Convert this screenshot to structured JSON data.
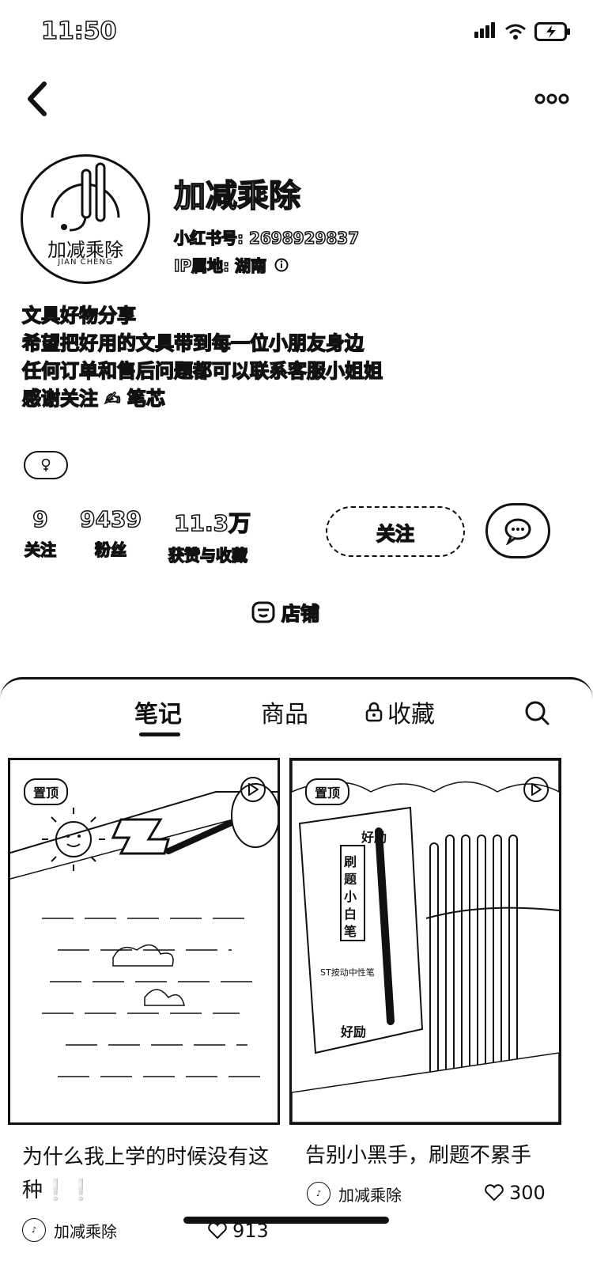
{
  "status": {
    "time": "11:50"
  },
  "profile": {
    "name": "加减乘除",
    "id_label": "小红书号: 2698929837",
    "ip_label": "IP属地: 湖南",
    "avatar_text": "加减乘除",
    "avatar_sub": "JIAN CHENG",
    "bio": [
      "文具好物分享",
      "希望把好用的文具带到每一位小朋友身边",
      "任何订单和售后问题都可以联系客服小姐姐",
      "感谢关注 ✍ 笔芯"
    ]
  },
  "stats": [
    {
      "value": "9",
      "label": "关注"
    },
    {
      "value": "9439",
      "label": "粉丝"
    },
    {
      "value": "11.3万",
      "label": "获赞与收藏"
    }
  ],
  "actions": {
    "follow": "关注",
    "shop": "店铺"
  },
  "tabs": [
    "笔记",
    "商品",
    "收藏"
  ],
  "cards": [
    {
      "pin": "置顶",
      "title": "为什么我上学的时候没有这种❕❕",
      "author": "加减乘除",
      "likes": "913"
    },
    {
      "pin": "置顶",
      "title": "告别小黑手，刷题不累手",
      "author": "加减乘除",
      "likes": "300",
      "img_brand": "好励",
      "img_words": "刷题小白笔",
      "img_sub": "ST按动中性笔"
    }
  ]
}
